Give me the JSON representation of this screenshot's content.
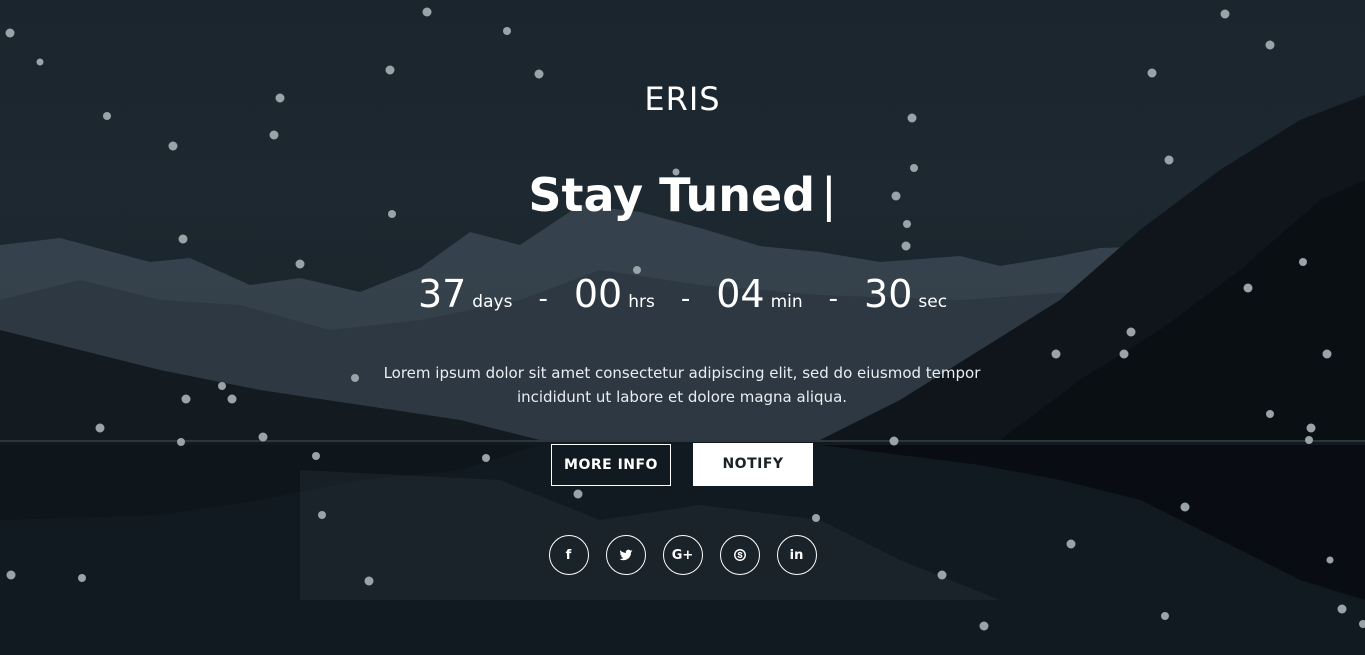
{
  "brand": {
    "logo": "ERIS"
  },
  "hero": {
    "headline": "Stay Tuned",
    "cursor": "|",
    "countdown": [
      {
        "value": "37",
        "unit": "days"
      },
      {
        "value": "00",
        "unit": "hrs"
      },
      {
        "value": "04",
        "unit": "min"
      },
      {
        "value": "30",
        "unit": "sec"
      }
    ],
    "separator": "-",
    "description_line1": "Lorem ipsum dolor sit amet consectetur adipiscing elit, sed do eiusmod tempor",
    "description_line2": "incididunt ut labore et dolore magna aliqua."
  },
  "actions": {
    "more_info_label": "MORE INFO",
    "notify_label": "NOTIFY"
  },
  "socials": [
    {
      "name": "facebook-icon",
      "glyph": "f"
    },
    {
      "name": "twitter-icon",
      "glyph": ""
    },
    {
      "name": "google-plus-icon",
      "glyph": "G+"
    },
    {
      "name": "skype-icon",
      "glyph": ""
    },
    {
      "name": "linkedin-icon",
      "glyph": "in"
    }
  ],
  "colors": {
    "text": "#ffffff",
    "background": "#1b252d",
    "particle": "#9aa3a8"
  }
}
